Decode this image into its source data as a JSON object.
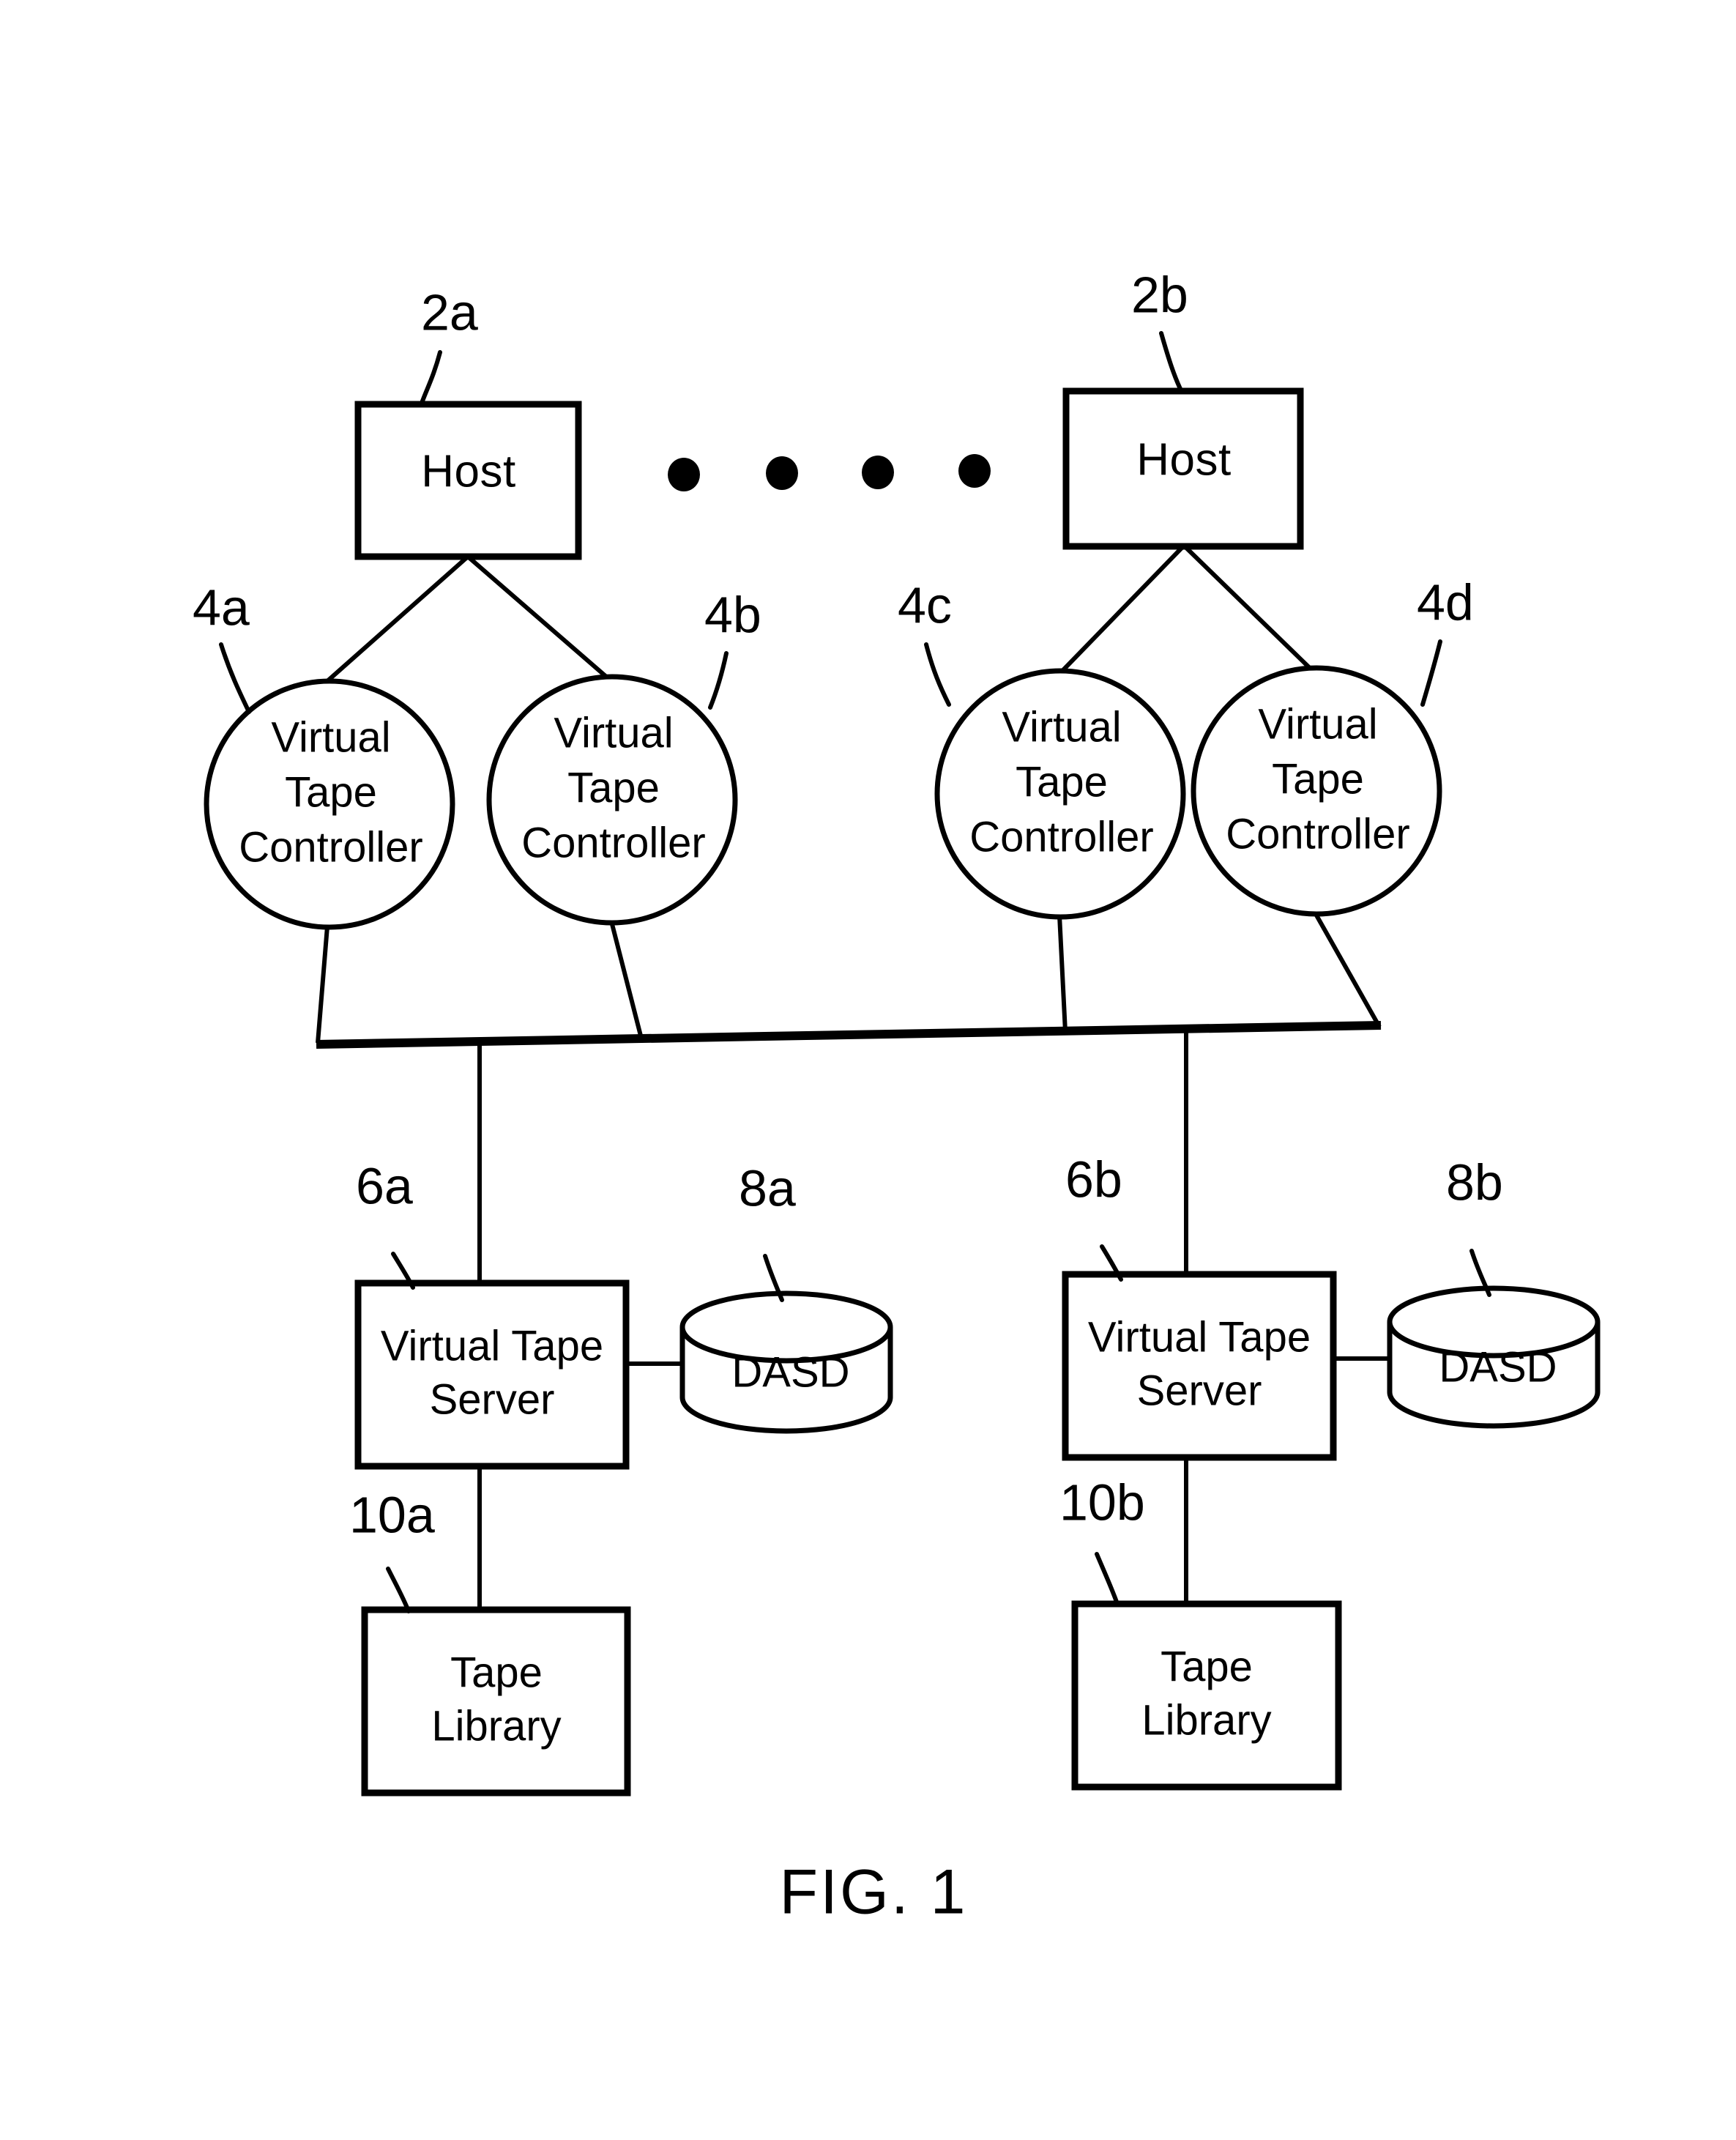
{
  "figure": {
    "caption": "FIG. 1",
    "title": "Virtual tape system block diagram"
  },
  "nodes": {
    "host_a": {
      "label": "Host",
      "ref": "2a"
    },
    "host_b": {
      "label": "Host",
      "ref": "2b"
    },
    "vtc_a": {
      "line1": "Virtual",
      "line2": "Tape",
      "line3": "Controller",
      "ref": "4a"
    },
    "vtc_b": {
      "line1": "Virtual",
      "line2": "Tape",
      "line3": "Controller",
      "ref": "4b"
    },
    "vtc_c": {
      "line1": "Virtual",
      "line2": "Tape",
      "line3": "Controller",
      "ref": "4c"
    },
    "vtc_d": {
      "line1": "Virtual",
      "line2": "Tape",
      "line3": "Controller",
      "ref": "4d"
    },
    "vts_a": {
      "line1": "Virtual Tape",
      "line2": "Server",
      "ref": "6a"
    },
    "vts_b": {
      "line1": "Virtual Tape",
      "line2": "Server",
      "ref": "6b"
    },
    "dasd_a": {
      "label": "DASD",
      "ref": "8a"
    },
    "dasd_b": {
      "label": "DASD",
      "ref": "8b"
    },
    "tapelib_a": {
      "line1": "Tape",
      "line2": "Library",
      "ref": "10a"
    },
    "tapelib_b": {
      "line1": "Tape",
      "line2": "Library",
      "ref": "10b"
    }
  },
  "ellipsis": {
    "name": "horizontal-ellipsis",
    "dot_count": 4
  },
  "colors": {
    "ink": "#000000",
    "paper": "#ffffff"
  }
}
